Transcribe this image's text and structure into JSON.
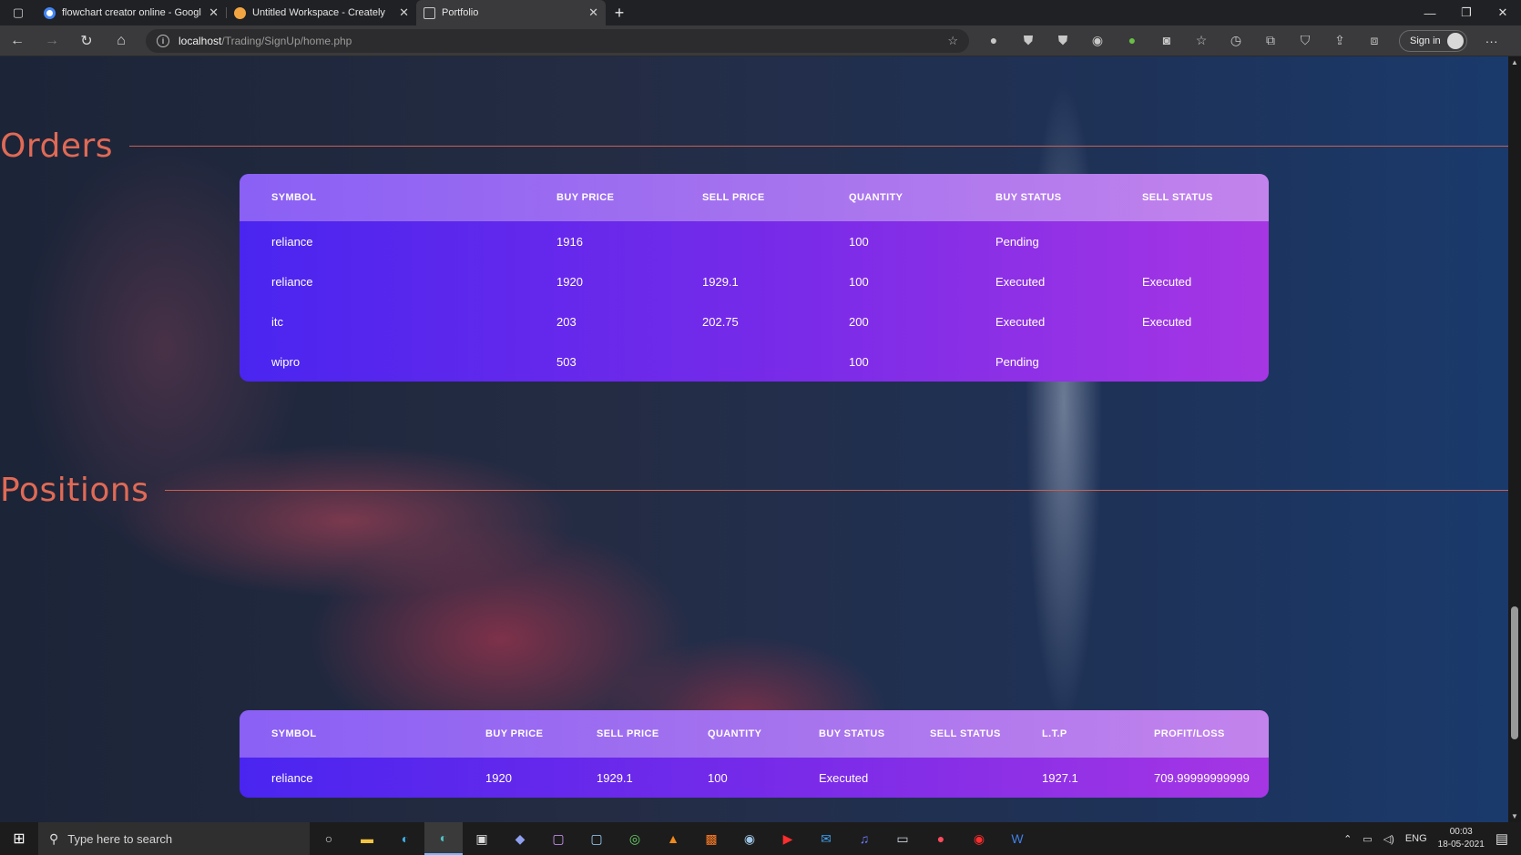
{
  "browser": {
    "tabs": [
      {
        "title": "flowchart creator online - Googl",
        "active": false,
        "favicon_color": "#ffffff"
      },
      {
        "title": "Untitled Workspace - Creately",
        "active": false,
        "favicon_color": "#f2a541"
      },
      {
        "title": "Portfolio",
        "active": true,
        "favicon_color": "#c9c9c9"
      }
    ],
    "url_host": "localhost",
    "url_path": "/Trading/SignUp/home.php",
    "sign_in_label": "Sign in"
  },
  "orders": {
    "title": "Orders",
    "columns": [
      "SYMBOL",
      "BUY PRICE",
      "SELL PRICE",
      "QUANTITY",
      "BUY STATUS",
      "SELL STATUS"
    ],
    "rows": [
      [
        "reliance",
        "1916",
        "",
        "100",
        "Pending",
        ""
      ],
      [
        "reliance",
        "1920",
        "1929.1",
        "100",
        "Executed",
        "Executed"
      ],
      [
        "itc",
        "203",
        "202.75",
        "200",
        "Executed",
        "Executed"
      ],
      [
        "wipro",
        "503",
        "",
        "100",
        "Pending",
        ""
      ]
    ]
  },
  "positions": {
    "title": "Positions",
    "columns": [
      "SYMBOL",
      "BUY PRICE",
      "SELL PRICE",
      "QUANTITY",
      "BUY STATUS",
      "SELL STATUS",
      "L.T.P",
      "PROFIT/LOSS"
    ],
    "rows": [
      [
        "reliance",
        "1920",
        "1929.1",
        "100",
        "Executed",
        "",
        "1927.1",
        "709.99999999999"
      ]
    ]
  },
  "taskbar": {
    "search_placeholder": "Type here to search",
    "language": "ENG",
    "time": "00:03",
    "date": "18-05-2021"
  },
  "colors": {
    "section_title": "#e06a55",
    "table_gradient_start": "#4a25f0",
    "table_gradient_end": "#a636e4"
  }
}
